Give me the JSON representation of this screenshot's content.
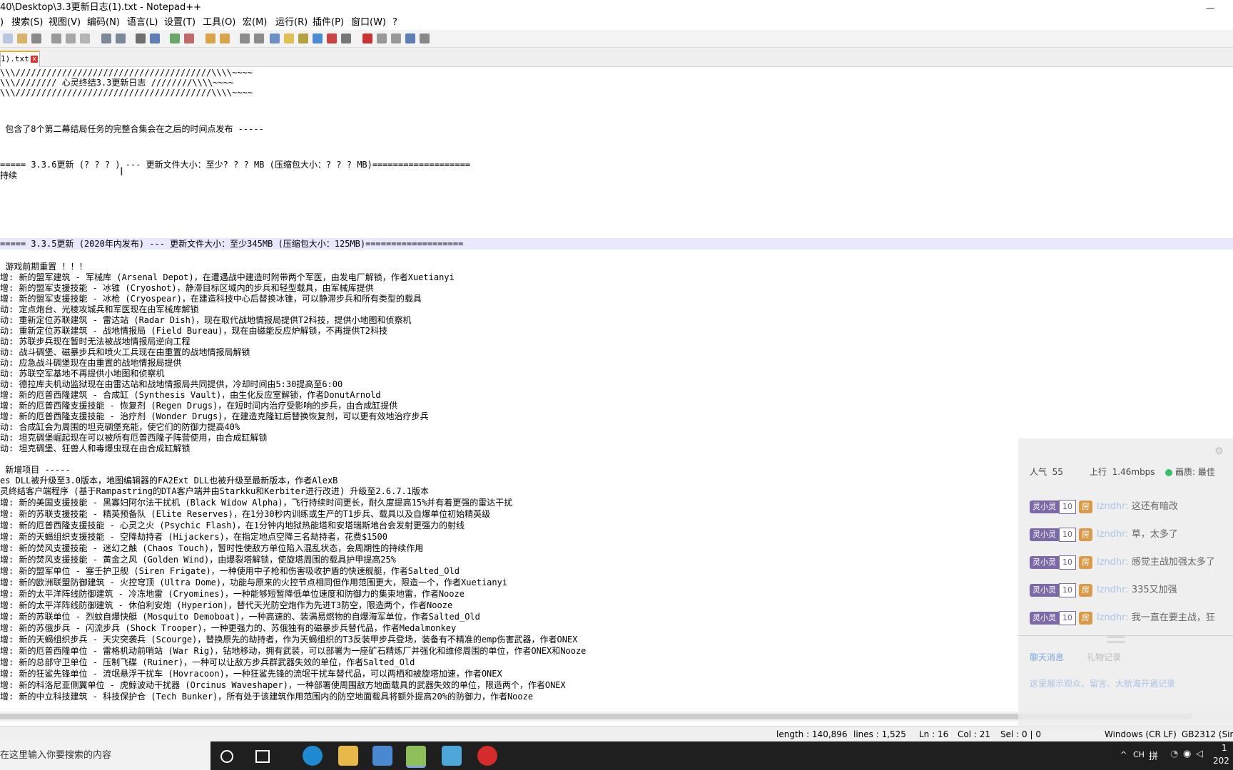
{
  "window": {
    "title": "40\\Desktop\\3.3更新日志(1).txt - Notepad++",
    "minimize": "—"
  },
  "menu": [
    "搜索(S)",
    "视图(V)",
    "编码(N)",
    "语言(L)",
    "设置(T)",
    "工具(O)",
    "宏(M)",
    "运行(R)",
    "插件(P)",
    "窗口(W)",
    "?"
  ],
  "tab": {
    "label": "1).txt",
    "close": "x"
  },
  "editor": {
    "lines": [
      "\\\\\\//////////////////////////////////////\\\\\\\\~~~~",
      "\\\\\\//////// 心灵终结3.3更新日志 ////////\\\\\\\\~~~~",
      "\\\\\\//////////////////////////////////////\\\\\\\\~~~~",
      "",
      "",
      " 包含了8个第二幕结局任务的完整合集会在之后的时间点发布 -----",
      "",
      "",
      "===== 3.3.6更新 (? ? ? ) --- 更新文件大小：至少? ? ? MB (压缩包大小：? ? ? MB)===================",
      "持续",
      "",
      "",
      "",
      "",
      "",
      "===== 3.3.5更新 (2020年内发布) --- 更新文件大小：至少345MB (压缩包大小：125MB)===================",
      "",
      " 游戏前期重置 ！！！",
      "增: 新的盟军建筑 - 军械库 (Arsenal Depot)，在遭遇战中建造时附带两个军医，由发电厂解锁，作者Xuetianyi",
      "增: 新的盟军支援技能 - 冰锥 (Cryoshot)，静滞目标区域内的步兵和轻型载具，由军械库提供",
      "增: 新的盟军支援技能 - 冰枪 (Cryospear)，在建造科技中心后替换冰锥，可以静滞步兵和所有类型的载具",
      "动: 定点炮台、光棱攻城兵和军医现在由军械库解锁",
      "动: 重新定位苏联建筑 - 雷达站 (Radar Dish)，现在取代战地情报局提供T2科技，提供小地图和侦察机",
      "动: 重新定位苏联建筑 - 战地情报局 (Field Bureau)，现在由磁能反应炉解锁，不再提供T2科技",
      "动: 苏联步兵现在暂时无法被战地情报局逆向工程",
      "动: 战斗碉堡、磁暴步兵和喷火工兵现在由重置的战地情报局解锁",
      "动: 应急战斗碉堡现在由重置的战地情报局提供",
      "动: 苏联空军基地不再提供小地图和侦察机",
      "动: 德拉库夫机动监狱现在由雷达站和战地情报局共同提供，冷却时间由5:30提高至6:00",
      "增: 新的厄普西隆建筑 - 合成缸 (Synthesis Vault)，由生化反应室解锁，作者DonutArnold",
      "增: 新的厄普西隆支援技能 - 恢复剂 (Regen Drugs)，在短时间内治疗受影响的步兵，由合成缸提供",
      "增: 新的厄普西隆支援技能 - 治疗剂 (Wonder Drugs)，在建造克隆缸后替换恢复剂，可以更有效地治疗步兵",
      "动: 合成缸会为周围的坦克碉堡充能，使它们的防御力提高40%",
      "动: 坦克碉堡崛起现在可以被所有厄普西隆子阵营使用，由合成缸解锁",
      "动: 坦克碉堡、狂兽人和毒爆虫现在由合成缸解锁",
      "",
      " 新增项目 -----",
      "es DLL被升级至3.0版本，地图编辑器的FA2Ext DLL也被升级至最新版本，作者AlexB",
      "灵终结客户端程序 (基于Rampastring的DTA客户端并由Starkku和Kerbiter进行改进) 升级至2.6.7.1版本",
      "增: 新的美国支援技能 - 黑寡妇阿尔法干扰机 (Black Widow Alpha)，飞行持续时间更长，耐久度提高15%并有着更强的雷达干扰",
      "增: 新的苏联支援技能 - 精英预备队 (Elite Reserves)，在1分30秒内训练或生产的T1步兵、载具以及自爆单位初始精英级",
      "增: 新的厄普西隆支援技能 - 心灵之火 (Psychic Flash)，在1分钟内地狱热能塔和安塔瑞斯地台会发射更强力的射线",
      "增: 新的天蝎组织支援技能 - 空降劫持者 (Hijackers)，在指定地点空降三名劫持者，花费$1500",
      "增: 新的焚风支援技能 - 迷幻之触 (Chaos Touch)，暂时性使敌方单位陷入混乱状态，会周期性的持续作用",
      "增: 新的焚风支援技能 - 黄金之风 (Golden Wind)，由爆裂塔解锁，使旋塔周围的载具护甲提高25%",
      "增: 新的盟军单位 - 塞壬护卫舰 (Siren Frigate)，一种使用中子枪和伤害吸收护盾的快速舰艇，作者Salted_Old",
      "增: 新的欧洲联盟防御建筑 - 火控穹顶 (Ultra Dome)，功能与原来的火控节点相同但作用范围更大，限造一个，作者Xuetianyi",
      "增: 新的太平洋阵线防御建筑 - 冷冻地雷 (Cryomines)，一种能够短暂降低单位速度和防御力的集束地雷，作者Nooze",
      "增: 新的太平洋阵线防御建筑 - 休伯利安炮 (Hyperion)，替代天光防空炮作为先进T3防空，限造两个，作者Nooze",
      "增: 新的苏联单位 - 烈蚊自爆快艇 (Mosquito Demoboat)，一种高速的、装满易燃物的自爆海军单位，作者Salted_Old",
      "增: 新的苏俄步兵 - 闪流步兵 (Shock Trooper)，一种更强力的、苏俄独有的磁暴步兵替代品，作者Medalmonkey",
      "增: 新的天蝎组织步兵 - 天灾突袭兵 (Scourge)，替换原先的劫持者，作为天蝎组织的T3反装甲步兵登场，装备有不精准的emp伤害武器，作者ONEX",
      "增: 新的厄普西隆单位 - 雷格机动前哨站 (War Rig)，钻地移动，拥有武装，可以部署为一座矿石精炼厂并强化和维修周围的单位，作者ONEX和Nooze",
      "增: 新的总部守卫单位 - 压制飞碟 (Ruiner)，一种可以让敌方步兵群武器失效的单位，作者Salted_Old",
      "增: 新的狂鲨先锋单位 - 流氓悬浮干扰车 (Hovracoon)，一种狂鲨先锋的流氓干扰车替代品，可以两栖和被旋塔加速，作者ONEX",
      "增: 新的科洛尼亚侧翼单位 - 虎鲸波动干扰器 (Orcinus Waveshaper)，一种部署使周围敌方地面载具的武器失效的单位，限造两个，作者ONEX",
      "增: 新的中立科技建筑 - 科技保护仓 (Tech Bunker)，所有处于该建筑作用范围内的防空地面载具将额外提高20%的防御力，作者Nooze"
    ],
    "cursor_glyph": "I"
  },
  "status": {
    "length": "length : 140,896",
    "lines": "lines : 1,525",
    "ln": "Ln : 16",
    "col": "Col : 21",
    "sel": "Sel : 0 | 0",
    "eol": "Windows (CR LF)",
    "encoding": "GB2312 (Sim"
  },
  "taskbar": {
    "search_placeholder": "在这里输入你要搜索的内容",
    "tray_lang": "CH",
    "tray_ime": "拼",
    "clock_time": "1",
    "clock_date": "202"
  },
  "live_overlay": {
    "popularity_label": "人气",
    "popularity": "55",
    "upload_label": "上行",
    "upload": "1.46mbps",
    "quality_label": "画质: 最佳",
    "messages": [
      {
        "tag": "灵小灵",
        "level": "10",
        "room": "房",
        "user": "lzndhr:",
        "text": "这还有暗改"
      },
      {
        "tag": "灵小灵",
        "level": "10",
        "room": "房",
        "user": "lzndhr:",
        "text": "草，太多了"
      },
      {
        "tag": "灵小灵",
        "level": "10",
        "room": "房",
        "user": "lzndhr:",
        "text": "感觉主战加强太多了"
      },
      {
        "tag": "灵小灵",
        "level": "10",
        "room": "房",
        "user": "lzndhr:",
        "text": "335又加强"
      },
      {
        "tag": "灵小灵",
        "level": "10",
        "room": "房",
        "user": "lzndhr:",
        "text": "我一直在要主战，狂"
      }
    ],
    "tab_a": "聊天消息",
    "tab_b": "礼物记录",
    "footer_note": "这里展示观众、留言、大航海开通记录",
    "gear": "⚙"
  },
  "colors": {
    "accent_tab": "#f0a830",
    "current_line": "#e8e8ff",
    "taskbar": "#1f1f1f"
  }
}
